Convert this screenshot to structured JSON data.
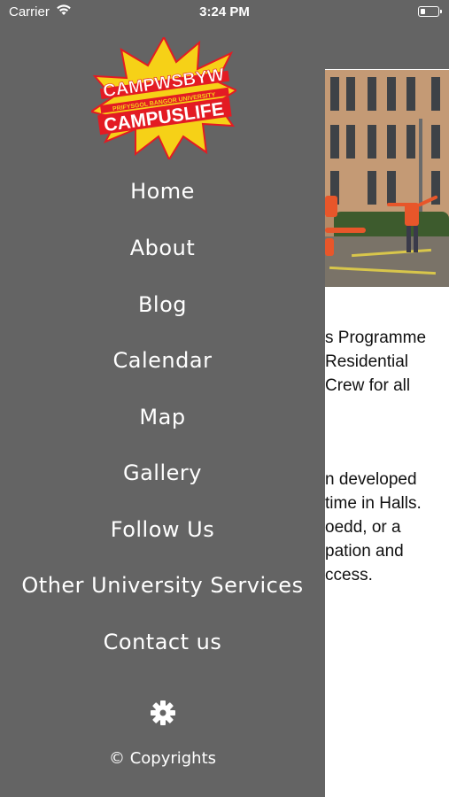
{
  "status_bar": {
    "carrier": "Carrier",
    "time": "3:24 PM",
    "battery_level": 0.25
  },
  "logo": {
    "line1": "CAMPWSBYW",
    "line2": "PRIFYSGOL BANGOR UNIVERSITY",
    "line3": "CAMPUSLIFE",
    "colors": {
      "burst": "#f6d117",
      "red": "#e31b23",
      "white": "#ffffff"
    }
  },
  "menu": {
    "items": [
      {
        "label": "Home"
      },
      {
        "label": "About"
      },
      {
        "label": "Blog"
      },
      {
        "label": "Calendar"
      },
      {
        "label": "Map"
      },
      {
        "label": "Gallery"
      },
      {
        "label": "Follow Us"
      },
      {
        "label": "Other University Services"
      },
      {
        "label": "Contact us"
      }
    ],
    "settings_icon": "gear-icon",
    "copyright": "© Copyrights"
  },
  "background_page": {
    "paragraph1": [
      "s Programme",
      "Residential",
      "Crew for all"
    ],
    "paragraph2": [
      "n developed",
      "time in Halls.",
      "oedd, or a",
      "pation and",
      "ccess."
    ]
  },
  "colors": {
    "drawer_bg": "#646464",
    "text": "#ffffff"
  }
}
